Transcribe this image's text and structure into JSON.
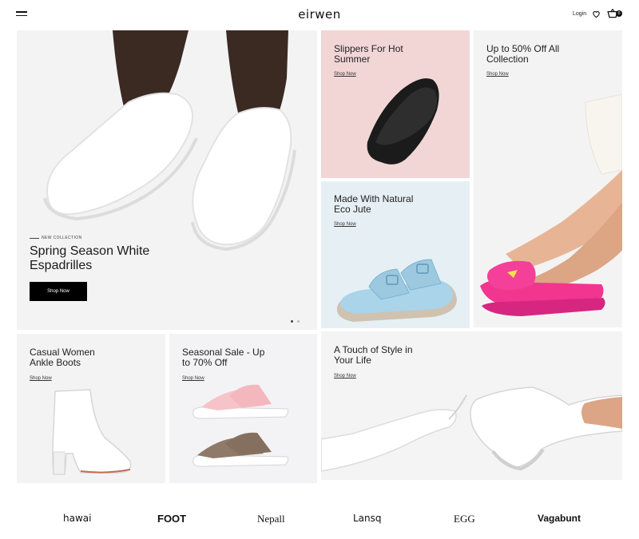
{
  "header": {
    "logo": "eirwen",
    "login_label": "Login",
    "cart_count": "0",
    "icons": [
      "menu-icon",
      "heart-icon",
      "cart-icon"
    ]
  },
  "hero": {
    "eyebrow": "NEW COLLECTION",
    "title_line1": "Spring Season White",
    "title_line2": "Espadrilles",
    "button_label": "Shop Now",
    "slide_count": 2,
    "active_slide": 1
  },
  "tiles": {
    "slippers": {
      "line1": "Slippers For Hot",
      "line2": "Summer",
      "link": "Shop Now",
      "bg": "#f2d6d6"
    },
    "discount": {
      "line1": "Up to 50% Off All",
      "line2": "Collection",
      "link": "Shop Now",
      "bg": "#f3f3f4"
    },
    "eco": {
      "line1": "Made With Natural",
      "line2": "Eco Jute",
      "link": "Shop Now",
      "bg": "#e6f0f4"
    },
    "boots": {
      "line1": "Casual Women",
      "line2": "Ankle Boots",
      "link": "Shop Now",
      "bg": "#f3f3f4"
    },
    "sale": {
      "line1": "Seasonal Sale - Up",
      "line2": "to 70% Off",
      "link": "Shop Now",
      "bg": "#f3f3f5"
    },
    "style": {
      "line1": "A Touch of Style in",
      "line2": "Your Life",
      "link": "Shop Now",
      "bg": "#f4f4f5"
    }
  },
  "brands": [
    "hawai",
    "FOOT",
    "Nepall",
    "Lansq",
    "EGG",
    "Vagabunt"
  ],
  "colors": {
    "accent": "#000000",
    "pink_slide": "#f2358f",
    "blue_sandal": "#a9d4ea",
    "pink_sandal": "#f6c3c8",
    "brown_sandal": "#8f7a6a"
  }
}
